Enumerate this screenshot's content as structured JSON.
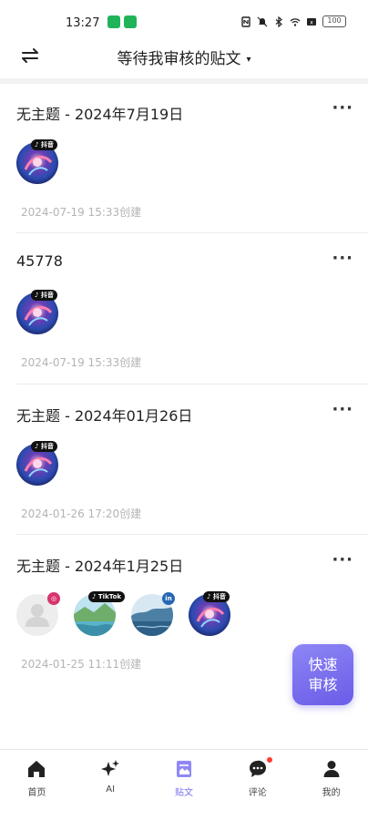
{
  "status_bar": {
    "time": "13:27",
    "battery": "100",
    "icons": [
      "wechat-icon",
      "message-icon",
      "nfc-icon",
      "mute-icon",
      "bluetooth-icon",
      "wifi-icon",
      "sim-icon",
      "battery-icon"
    ]
  },
  "header": {
    "title": "等待我审核的贴文",
    "caret": "▾",
    "left_icon": "swap-icon"
  },
  "posts": [
    {
      "title": "无主题 - 2024年7月19日",
      "date": "2024-07-19 15:33创建",
      "more": "···",
      "accounts": [
        {
          "platform": "抖音",
          "avatar": "tiktok-galaxy"
        }
      ]
    },
    {
      "title": "45778",
      "date": "2024-07-19 15:33创建",
      "more": "···",
      "accounts": [
        {
          "platform": "抖音",
          "avatar": "tiktok-galaxy"
        }
      ]
    },
    {
      "title": "无主题 - 2024年01月26日",
      "date": "2024-01-26 17:20创建",
      "more": "···",
      "accounts": [
        {
          "platform": "抖音",
          "avatar": "tiktok-galaxy"
        }
      ]
    },
    {
      "title": "无主题 - 2024年1月25日",
      "date": "2024-01-25 11:11创建",
      "more": "···",
      "accounts": [
        {
          "platform": "instagram",
          "avatar": "default-user"
        },
        {
          "platform": "TikTok",
          "avatar": "landscape-green"
        },
        {
          "platform": "in",
          "avatar": "landscape-lake"
        },
        {
          "platform": "抖音",
          "avatar": "tiktok-galaxy"
        }
      ]
    }
  ],
  "fab": {
    "line1": "快速",
    "line2": "审核"
  },
  "nav": [
    {
      "label": "首页",
      "icon": "home-icon",
      "active": false
    },
    {
      "label": "AI",
      "icon": "sparkle-icon",
      "active": false
    },
    {
      "label": "贴文",
      "icon": "post-icon",
      "active": true
    },
    {
      "label": "评论",
      "icon": "comment-icon",
      "active": false
    },
    {
      "label": "我的",
      "icon": "profile-icon",
      "active": false
    }
  ],
  "colors": {
    "accent": "#7b72f0",
    "fab_start": "#8d86f5",
    "fab_end": "#6a5ce8",
    "date_text": "#b4b4b4",
    "notification": "#ff3b30"
  }
}
